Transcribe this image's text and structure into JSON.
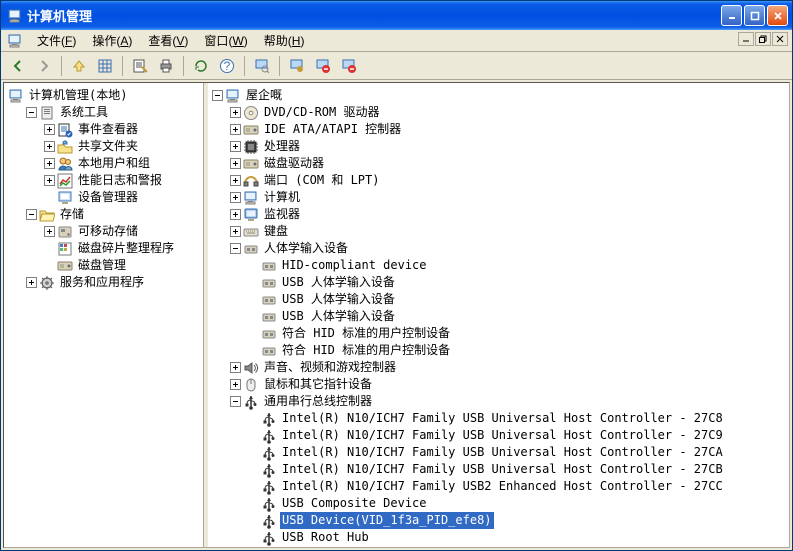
{
  "window": {
    "title": "计算机管理"
  },
  "menu": {
    "file": {
      "label": "文件",
      "accel": "F"
    },
    "action": {
      "label": "操作",
      "accel": "A"
    },
    "view": {
      "label": "查看",
      "accel": "V"
    },
    "window": {
      "label": "窗口",
      "accel": "W"
    },
    "help": {
      "label": "帮助",
      "accel": "H"
    }
  },
  "left": {
    "root": "计算机管理(本地)",
    "system_tools": "系统工具",
    "event_viewer": "事件查看器",
    "shared_folders": "共享文件夹",
    "local_users": "本地用户和组",
    "perf_logs": "性能日志和警报",
    "device_manager": "设备管理器",
    "storage": "存储",
    "removable": "可移动存储",
    "defrag": "磁盘碎片整理程序",
    "disk_mgmt": "磁盘管理",
    "services_apps": "服务和应用程序"
  },
  "right": {
    "root": "屋企嘅",
    "dvd": "DVD/CD-ROM 驱动器",
    "ide": "IDE ATA/ATAPI 控制器",
    "cpu": "处理器",
    "disk_drives": "磁盘驱动器",
    "ports": "端口 (COM 和 LPT)",
    "computer": "计算机",
    "monitor": "监视器",
    "keyboard": "键盘",
    "hid": "人体学输入设备",
    "hid_items": [
      "HID-compliant device",
      "USB 人体学输入设备",
      "USB 人体学输入设备",
      "USB 人体学输入设备",
      "符合 HID 标准的用户控制设备",
      "符合 HID 标准的用户控制设备"
    ],
    "sound": "声音、视频和游戏控制器",
    "mouse": "鼠标和其它指针设备",
    "usb": "通用串行总线控制器",
    "usb_items": [
      "Intel(R) N10/ICH7 Family USB Universal Host Controller - 27C8",
      "Intel(R) N10/ICH7 Family USB Universal Host Controller - 27C9",
      "Intel(R) N10/ICH7 Family USB Universal Host Controller - 27CA",
      "Intel(R) N10/ICH7 Family USB Universal Host Controller - 27CB",
      "Intel(R) N10/ICH7 Family USB2 Enhanced Host Controller - 27CC",
      "USB Composite Device",
      "USB Device(VID_1f3a_PID_efe8)",
      "USB Root Hub"
    ],
    "selected": "USB Device(VID_1f3a_PID_efe8)"
  }
}
